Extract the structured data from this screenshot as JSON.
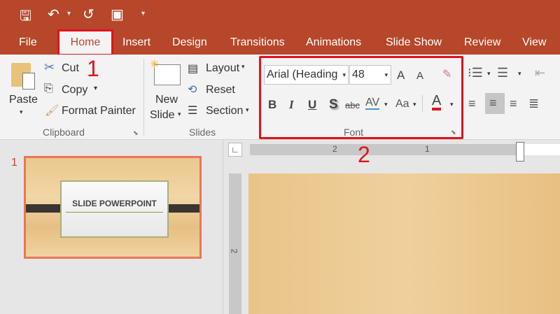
{
  "quick_access": {
    "icons": [
      "save-icon",
      "undo-icon",
      "redo-icon",
      "start-from-beginning-icon",
      "customize-icon"
    ]
  },
  "tabs": [
    {
      "label": "File"
    },
    {
      "label": "Home",
      "active": true
    },
    {
      "label": "Insert"
    },
    {
      "label": "Design"
    },
    {
      "label": "Transitions"
    },
    {
      "label": "Animations"
    },
    {
      "label": "Slide Show"
    },
    {
      "label": "Review"
    },
    {
      "label": "View"
    }
  ],
  "annotations": {
    "one": "1",
    "two": "2"
  },
  "clipboard": {
    "paste": "Paste",
    "cut": "Cut",
    "copy": "Copy",
    "format_painter": "Format Painter",
    "group": "Clipboard"
  },
  "slides": {
    "new_slide_1": "New",
    "new_slide_2": "Slide",
    "layout": "Layout",
    "reset": "Reset",
    "section": "Section",
    "group": "Slides"
  },
  "font": {
    "font_name": "Arial (Heading",
    "font_size": "48",
    "bold": "B",
    "italic": "I",
    "underline": "U",
    "shadow": "S",
    "strike": "abc",
    "spacing": "AV",
    "case": "Aa",
    "color_label": "A",
    "grow": "A",
    "shrink": "A",
    "group": "Font",
    "font_color": "#e0131b"
  },
  "ruler": {
    "h_labels": [
      "2",
      "1"
    ],
    "v_labels": [
      "2"
    ]
  },
  "thumbnails": [
    {
      "number": "1",
      "title": "SLIDE POWERPOINT"
    }
  ],
  "colors": {
    "accent": "#b7472a",
    "highlight": "#e0131b",
    "selection": "#e8765a",
    "wood": "#e9c48a"
  }
}
